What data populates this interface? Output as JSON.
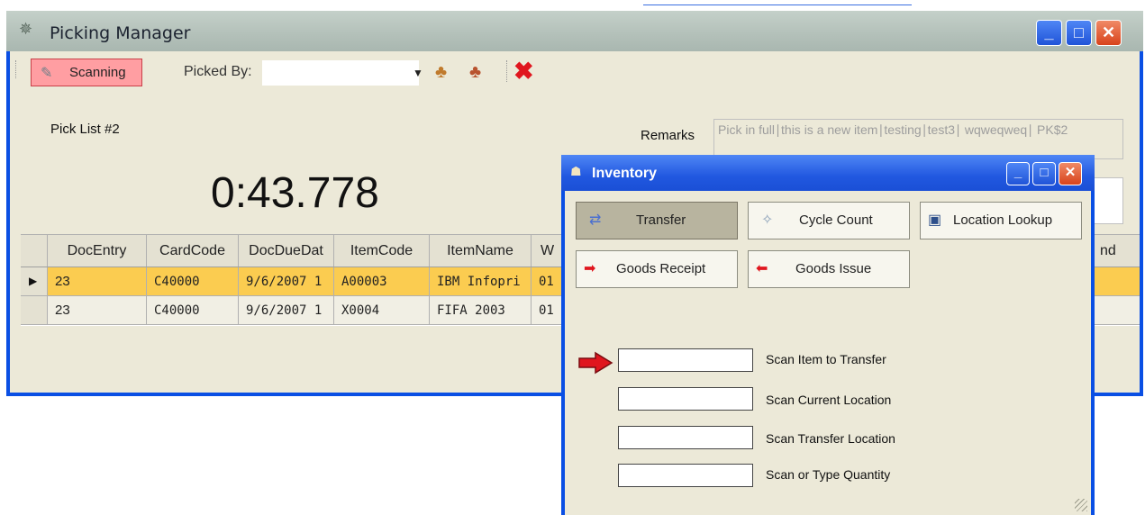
{
  "main_window": {
    "title": "Picking Manager",
    "toolbar": {
      "scanning_label": "Scanning",
      "picked_by_label": "Picked By:",
      "picked_by_value": ""
    },
    "pick_list_label": "Pick List #2",
    "timer": "0:43.778",
    "remarks_label": "Remarks",
    "remarks_text": "Pick in full∣this is a new item∣testing∣test3∣ wqweqweq∣ PK$2",
    "grid": {
      "columns": [
        "DocEntry",
        "CardCode",
        "DocDueDat",
        "ItemCode",
        "ItemName",
        "W",
        "nd"
      ],
      "rows": [
        [
          "23",
          "C40000",
          "9/6/2007 1",
          "A00003",
          "IBM Infopri",
          "01"
        ],
        [
          "23",
          "C40000",
          "9/6/2007 1",
          "X0004",
          "FIFA 2003",
          "01"
        ]
      ]
    }
  },
  "inventory_window": {
    "title": "Inventory",
    "buttons": {
      "transfer": "Transfer",
      "cycle_count": "Cycle Count",
      "location_lookup": "Location Lookup",
      "goods_receipt": "Goods Receipt",
      "goods_issue": "Goods Issue"
    },
    "scan_fields": [
      {
        "label": "Scan Item to Transfer",
        "value": ""
      },
      {
        "label": "Scan Current Location",
        "value": ""
      },
      {
        "label": "Scan Transfer Location",
        "value": ""
      },
      {
        "label": "Scan or Type Quantity",
        "value": ""
      }
    ]
  },
  "colors": {
    "selected_row": "#fbcc50",
    "scanning_active": "#ff9ea2",
    "window_frame": "#0a4fe4"
  }
}
